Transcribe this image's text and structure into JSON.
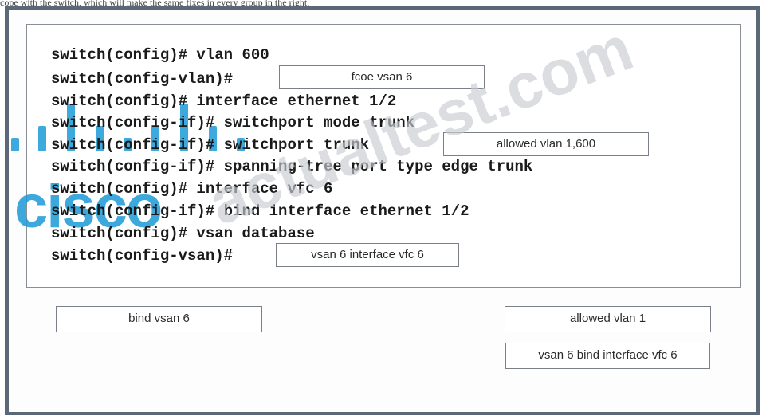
{
  "header_fragment": "cope with the switch, which will make the same fixes in every group in the right.",
  "code_lines": [
    "switch(config)# vlan 600",
    "switch(config-vlan)#",
    "switch(config)# interface ethernet 1/2",
    "switch(config-if)# switchport mode trunk",
    "switch(config-if)# switchport trunk",
    "switch(config-if)# spanning-tree port type edge trunk",
    "switch(config)# interface vfc 6",
    "switch(config-if)# bind interface ethernet 1/2",
    "switch(config)# vsan database",
    "switch(config-vsan)#"
  ],
  "answer_slots": {
    "slot1": "fcoe vsan 6",
    "slot2": "allowed vlan 1,600",
    "slot3": "vsan 6 interface vfc 6"
  },
  "choices": {
    "bind_vsan_6": "bind vsan 6",
    "allowed_vlan_1": "allowed vlan 1",
    "vsan_6_bind": "vsan 6 bind interface vfc 6"
  },
  "watermarks": {
    "logo_text": "cisco",
    "site_text": "actualtest.com"
  },
  "colors": {
    "frame": "#5a6878",
    "cisco_blue": "#1b9ad6",
    "watermark_gray": "#c8ccd2"
  }
}
